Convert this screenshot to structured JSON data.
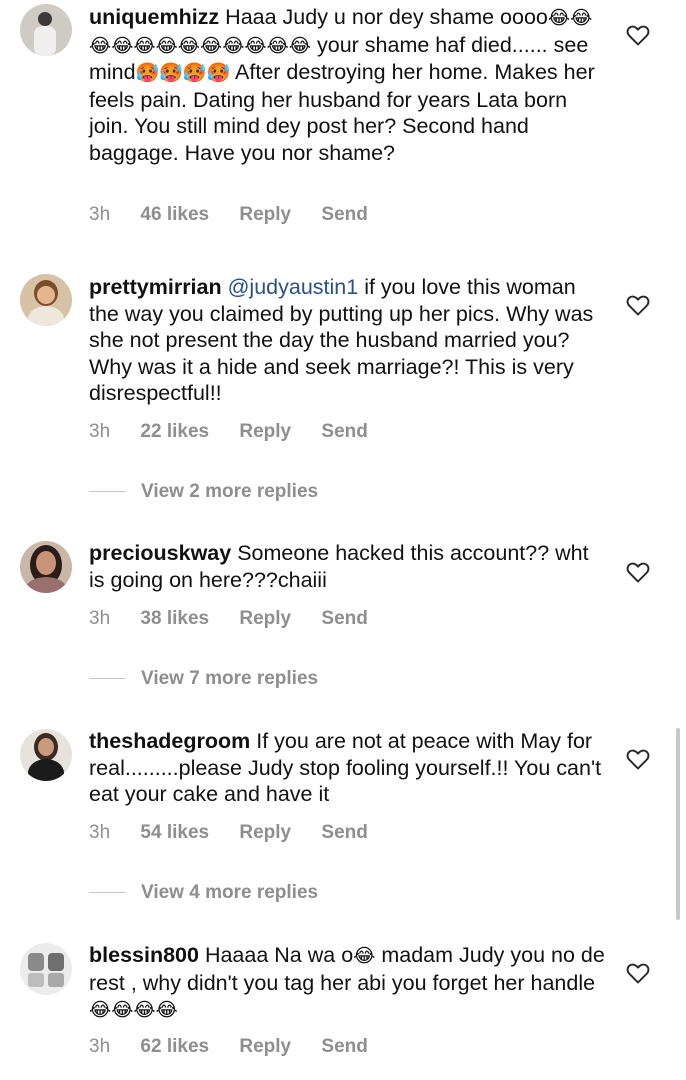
{
  "comments": [
    {
      "username": "uniquemhizz",
      "text_parts": [
        "Haaa  Judy u nor dey shame oooo",
        "😂😂😂😂😂😂😂😂😂😂😂😂",
        " your shame haf died...... see mind",
        "🥵🥵🥵🥵",
        " After destroying her home. Makes her feels pain. Dating her husband for years Lata born join. You still mind dey post her? Second hand baggage. Have you nor shame?"
      ],
      "time": "3h",
      "likes": "46 likes",
      "reply": "Reply",
      "send": "Send"
    },
    {
      "username": "prettymirrian",
      "mention": "@judyaustin1",
      "text": " if you love this woman the way you claimed by putting up her pics. Why was she not present the day the husband married you? Why was it a hide and seek marriage?! This is very disrespectful!!",
      "time": "3h",
      "likes": "22 likes",
      "reply": "Reply",
      "send": "Send",
      "view_replies": "View 2 more replies"
    },
    {
      "username": "preciouskway",
      "text": "Someone hacked this account?? wht is going on here???chaiii",
      "time": "3h",
      "likes": "38 likes",
      "reply": "Reply",
      "send": "Send",
      "view_replies": "View 7 more replies"
    },
    {
      "username": "theshadegroom",
      "text": "If you are not at peace with May for real.........please Judy stop fooling yourself.!! You can't eat your cake and have it",
      "time": "3h",
      "likes": "54 likes",
      "reply": "Reply",
      "send": "Send",
      "view_replies": "View 4 more replies"
    },
    {
      "username": "blessin800",
      "text_parts": [
        "Haaaa Na wa o",
        "😂",
        "  madam Judy you no de rest , why didn't you tag her abi you forget her handle",
        "😂😂😂😂"
      ],
      "time": "3h",
      "likes": "62 likes",
      "reply": "Reply",
      "send": "Send"
    }
  ],
  "icons": {
    "heart": "heart-outline-icon"
  },
  "colors": {
    "meta": "#8e8e8e",
    "mention": "#2a4f8a",
    "text": "#111111"
  }
}
